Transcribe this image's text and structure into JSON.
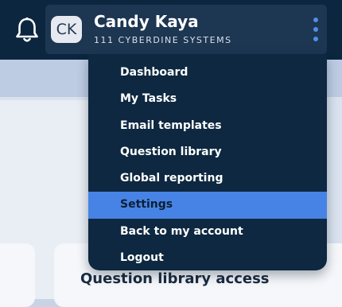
{
  "header": {
    "user": {
      "initials": "CK",
      "name": "Candy Kaya",
      "organization": "111 CYBERDINE SYSTEMS"
    },
    "icons": {
      "notifications": "bell-icon",
      "more": "kebab-menu-icon"
    },
    "colors": {
      "bar_background": "#0c2640",
      "card_background": "#1d3652",
      "kebab_dots": "#4f8fe6"
    }
  },
  "menu": {
    "items": [
      {
        "label": "Dashboard",
        "selected": false
      },
      {
        "label": "My Tasks",
        "selected": false
      },
      {
        "label": "Email templates",
        "selected": false
      },
      {
        "label": "Question library",
        "selected": false
      },
      {
        "label": "Global reporting",
        "selected": false
      },
      {
        "label": "Settings",
        "selected": true
      },
      {
        "label": "Back to my account",
        "selected": false
      },
      {
        "label": "Logout",
        "selected": false
      }
    ],
    "colors": {
      "background": "#0d2840",
      "highlight": "#4683e5"
    }
  },
  "page": {
    "card_title": "Question library access"
  }
}
